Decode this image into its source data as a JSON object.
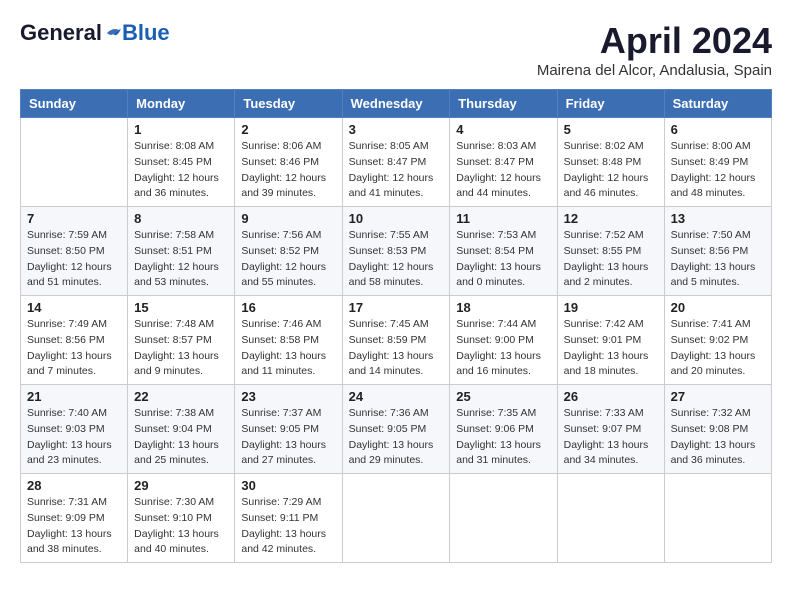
{
  "header": {
    "logo_general": "General",
    "logo_blue": "Blue",
    "month_title": "April 2024",
    "location": "Mairena del Alcor, Andalusia, Spain"
  },
  "calendar": {
    "days_of_week": [
      "Sunday",
      "Monday",
      "Tuesday",
      "Wednesday",
      "Thursday",
      "Friday",
      "Saturday"
    ],
    "weeks": [
      [
        {
          "day": "",
          "sunrise": "",
          "sunset": "",
          "daylight": ""
        },
        {
          "day": "1",
          "sunrise": "Sunrise: 8:08 AM",
          "sunset": "Sunset: 8:45 PM",
          "daylight": "Daylight: 12 hours and 36 minutes."
        },
        {
          "day": "2",
          "sunrise": "Sunrise: 8:06 AM",
          "sunset": "Sunset: 8:46 PM",
          "daylight": "Daylight: 12 hours and 39 minutes."
        },
        {
          "day": "3",
          "sunrise": "Sunrise: 8:05 AM",
          "sunset": "Sunset: 8:47 PM",
          "daylight": "Daylight: 12 hours and 41 minutes."
        },
        {
          "day": "4",
          "sunrise": "Sunrise: 8:03 AM",
          "sunset": "Sunset: 8:47 PM",
          "daylight": "Daylight: 12 hours and 44 minutes."
        },
        {
          "day": "5",
          "sunrise": "Sunrise: 8:02 AM",
          "sunset": "Sunset: 8:48 PM",
          "daylight": "Daylight: 12 hours and 46 minutes."
        },
        {
          "day": "6",
          "sunrise": "Sunrise: 8:00 AM",
          "sunset": "Sunset: 8:49 PM",
          "daylight": "Daylight: 12 hours and 48 minutes."
        }
      ],
      [
        {
          "day": "7",
          "sunrise": "Sunrise: 7:59 AM",
          "sunset": "Sunset: 8:50 PM",
          "daylight": "Daylight: 12 hours and 51 minutes."
        },
        {
          "day": "8",
          "sunrise": "Sunrise: 7:58 AM",
          "sunset": "Sunset: 8:51 PM",
          "daylight": "Daylight: 12 hours and 53 minutes."
        },
        {
          "day": "9",
          "sunrise": "Sunrise: 7:56 AM",
          "sunset": "Sunset: 8:52 PM",
          "daylight": "Daylight: 12 hours and 55 minutes."
        },
        {
          "day": "10",
          "sunrise": "Sunrise: 7:55 AM",
          "sunset": "Sunset: 8:53 PM",
          "daylight": "Daylight: 12 hours and 58 minutes."
        },
        {
          "day": "11",
          "sunrise": "Sunrise: 7:53 AM",
          "sunset": "Sunset: 8:54 PM",
          "daylight": "Daylight: 13 hours and 0 minutes."
        },
        {
          "day": "12",
          "sunrise": "Sunrise: 7:52 AM",
          "sunset": "Sunset: 8:55 PM",
          "daylight": "Daylight: 13 hours and 2 minutes."
        },
        {
          "day": "13",
          "sunrise": "Sunrise: 7:50 AM",
          "sunset": "Sunset: 8:56 PM",
          "daylight": "Daylight: 13 hours and 5 minutes."
        }
      ],
      [
        {
          "day": "14",
          "sunrise": "Sunrise: 7:49 AM",
          "sunset": "Sunset: 8:56 PM",
          "daylight": "Daylight: 13 hours and 7 minutes."
        },
        {
          "day": "15",
          "sunrise": "Sunrise: 7:48 AM",
          "sunset": "Sunset: 8:57 PM",
          "daylight": "Daylight: 13 hours and 9 minutes."
        },
        {
          "day": "16",
          "sunrise": "Sunrise: 7:46 AM",
          "sunset": "Sunset: 8:58 PM",
          "daylight": "Daylight: 13 hours and 11 minutes."
        },
        {
          "day": "17",
          "sunrise": "Sunrise: 7:45 AM",
          "sunset": "Sunset: 8:59 PM",
          "daylight": "Daylight: 13 hours and 14 minutes."
        },
        {
          "day": "18",
          "sunrise": "Sunrise: 7:44 AM",
          "sunset": "Sunset: 9:00 PM",
          "daylight": "Daylight: 13 hours and 16 minutes."
        },
        {
          "day": "19",
          "sunrise": "Sunrise: 7:42 AM",
          "sunset": "Sunset: 9:01 PM",
          "daylight": "Daylight: 13 hours and 18 minutes."
        },
        {
          "day": "20",
          "sunrise": "Sunrise: 7:41 AM",
          "sunset": "Sunset: 9:02 PM",
          "daylight": "Daylight: 13 hours and 20 minutes."
        }
      ],
      [
        {
          "day": "21",
          "sunrise": "Sunrise: 7:40 AM",
          "sunset": "Sunset: 9:03 PM",
          "daylight": "Daylight: 13 hours and 23 minutes."
        },
        {
          "day": "22",
          "sunrise": "Sunrise: 7:38 AM",
          "sunset": "Sunset: 9:04 PM",
          "daylight": "Daylight: 13 hours and 25 minutes."
        },
        {
          "day": "23",
          "sunrise": "Sunrise: 7:37 AM",
          "sunset": "Sunset: 9:05 PM",
          "daylight": "Daylight: 13 hours and 27 minutes."
        },
        {
          "day": "24",
          "sunrise": "Sunrise: 7:36 AM",
          "sunset": "Sunset: 9:05 PM",
          "daylight": "Daylight: 13 hours and 29 minutes."
        },
        {
          "day": "25",
          "sunrise": "Sunrise: 7:35 AM",
          "sunset": "Sunset: 9:06 PM",
          "daylight": "Daylight: 13 hours and 31 minutes."
        },
        {
          "day": "26",
          "sunrise": "Sunrise: 7:33 AM",
          "sunset": "Sunset: 9:07 PM",
          "daylight": "Daylight: 13 hours and 34 minutes."
        },
        {
          "day": "27",
          "sunrise": "Sunrise: 7:32 AM",
          "sunset": "Sunset: 9:08 PM",
          "daylight": "Daylight: 13 hours and 36 minutes."
        }
      ],
      [
        {
          "day": "28",
          "sunrise": "Sunrise: 7:31 AM",
          "sunset": "Sunset: 9:09 PM",
          "daylight": "Daylight: 13 hours and 38 minutes."
        },
        {
          "day": "29",
          "sunrise": "Sunrise: 7:30 AM",
          "sunset": "Sunset: 9:10 PM",
          "daylight": "Daylight: 13 hours and 40 minutes."
        },
        {
          "day": "30",
          "sunrise": "Sunrise: 7:29 AM",
          "sunset": "Sunset: 9:11 PM",
          "daylight": "Daylight: 13 hours and 42 minutes."
        },
        {
          "day": "",
          "sunrise": "",
          "sunset": "",
          "daylight": ""
        },
        {
          "day": "",
          "sunrise": "",
          "sunset": "",
          "daylight": ""
        },
        {
          "day": "",
          "sunrise": "",
          "sunset": "",
          "daylight": ""
        },
        {
          "day": "",
          "sunrise": "",
          "sunset": "",
          "daylight": ""
        }
      ]
    ]
  }
}
